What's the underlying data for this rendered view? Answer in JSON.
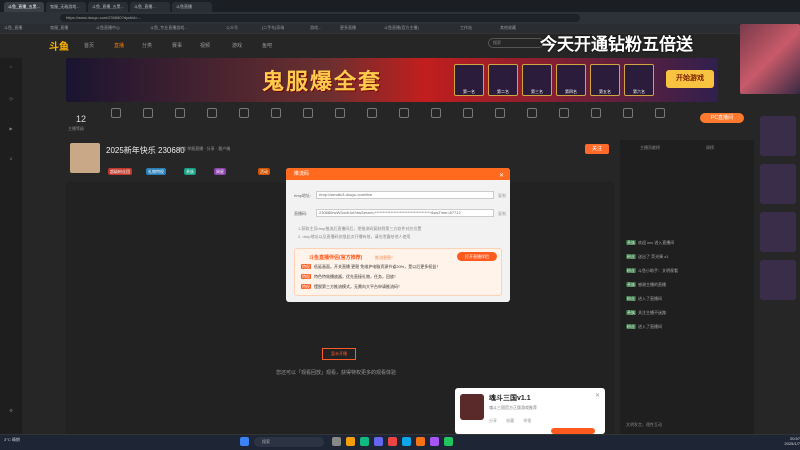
{
  "browser": {
    "tabs": [
      "斗鱼_直播_五黑...",
      "鬼服_无敌游戏...",
      "斗鱼_直播_五黑...",
      "斗鱼_直播...",
      "斗鱼直播"
    ],
    "url": "https://www.douyu.com/230680?dyshid=...",
    "bookmarks": [
      "斗鱼_直播",
      "鬼服_直播",
      "斗鱼直播中心",
      "斗鱼_专业直播游戏...",
      "公众号",
      "[二手车]奇瑞",
      "游戏...",
      "更多直播",
      "斗鱼直播(官方主播)",
      "工作站",
      "其他收藏"
    ]
  },
  "site": {
    "logo": "斗鱼",
    "nav": [
      "首页",
      "直播",
      "分类",
      "赛事",
      "视频",
      "游戏",
      "鱼吧"
    ],
    "active_nav": "直播",
    "search_placeholder": "搜索",
    "promo_overlay": "今天开通钻粉五倍送"
  },
  "banner": {
    "title": "鬼服爆全套",
    "prizes": [
      "第一名",
      "第二名",
      "第三名",
      "第四名",
      "第五名",
      "第六名"
    ],
    "play_label": "开始游戏"
  },
  "giftbar": {
    "count": "12",
    "count_label": "主播等级",
    "pc_button": "PC直播间"
  },
  "anchor": {
    "title": "2025新年快乐 230680",
    "meta": "体验  举报直播 · 分享 · 客户端",
    "tags": [
      "超级粉丝团",
      "礼物特权",
      "贵族",
      "周星",
      "活动"
    ],
    "follow": "关注"
  },
  "player": {
    "offline_button": "暂未开播",
    "offline_hint": "您还可以「观看回放」观看，获得特权更多的观看体验"
  },
  "modal": {
    "title": "推流码",
    "server_label": "rtmp地址:",
    "server_value": "rtmp://sendtc3.douyu.com/live",
    "key_label": "直播码:",
    "key_value": "230680rwW3uxK4d?wsSecret=************************************&wsTime=67712",
    "copy": "复制",
    "note1": "1.获取主页rtmp推流后直播间后，把推流码复制到第三方软件对应位置",
    "note2": "2. rtmp地址以及直播码仅限此次开播有效，请勿泄露给他人使用",
    "ad_title": "斗鱼直播伴侣(官方推荐)",
    "ad_sub": "推流更稳！",
    "ad_button": "打开直播伴侣",
    "ad_lines": [
      {
        "tag": "特权",
        "text": "低延画面，开关直播 更稳 免维护电脑资源节省20%，是以后更多权益！"
      },
      {
        "tag": "特权",
        "text": "特色特效播放器，优先直接礼物，任务，回放！"
      },
      {
        "tag": "特权",
        "text": "摆脱第三方推流模式，无需向大平台申请推流码！"
      }
    ]
  },
  "right_panel": {
    "header": "主播贡献榜",
    "rank_label": "周榜",
    "chat": [
      {
        "tag": "贵族",
        "text": "欢迎 xxx 进入直播间"
      },
      {
        "tag": "粉丝",
        "text": "送出了 荧光棒 x1"
      },
      {
        "tag": "粉丝",
        "text": "斗鱼小助手：文明观看"
      },
      {
        "tag": "贵族",
        "text": "感谢主播的直播"
      },
      {
        "tag": "粉丝",
        "text": "进入了直播间"
      },
      {
        "tag": "贵族",
        "text": "关注主播不迷路"
      },
      {
        "tag": "粉丝",
        "text": "进入了直播间"
      }
    ],
    "footer": "文明发言，理性互动"
  },
  "game_popup": {
    "title": "魂斗三国v1.1",
    "desc": "魂斗三国官方正版游戏推荐",
    "actions": [
      "分享",
      "收藏",
      "举报"
    ]
  },
  "taskbar": {
    "weather": "3°C\n晴朗",
    "search": "搜索",
    "time": "20:57\n2025/1/7"
  },
  "colors": {
    "accent": "#ff6a1e",
    "brand": "#ffb400"
  }
}
